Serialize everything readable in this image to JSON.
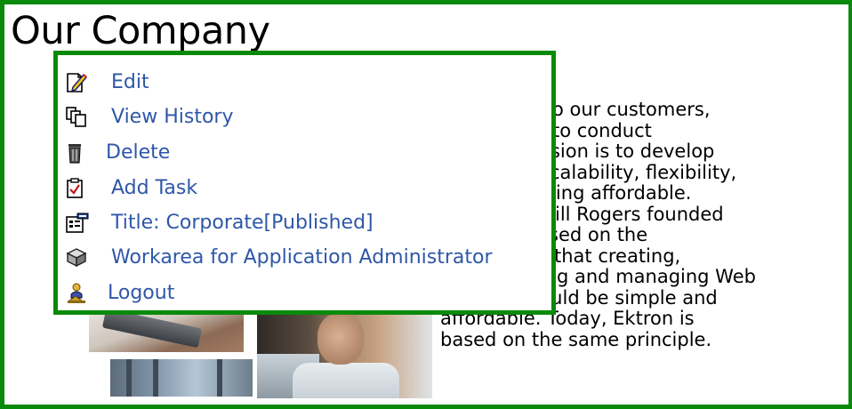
{
  "page": {
    "title": "Our Company",
    "body_lines": [
      "o our customers,",
      " to conduct",
      "ssion is to develop",
      "calability, flexibility,",
      "eing affordable.",
      "ill Rogers founded",
      "sed on the",
      " that creating,",
      "g and managing Web",
      "content should be simple and",
      "affordable.  Today, Ektron is",
      "based on the same principle."
    ]
  },
  "menu": {
    "items": [
      {
        "label": "Edit",
        "icon": "edit-icon"
      },
      {
        "label": "View History",
        "icon": "view-history-icon"
      },
      {
        "label": "Delete",
        "icon": "trash-icon"
      },
      {
        "label": "Add Task",
        "icon": "clipboard-check-icon"
      },
      {
        "label": "Title: Corporate[Published]",
        "icon": "properties-icon"
      },
      {
        "label": "Workarea for Application Administrator",
        "icon": "workarea-icon"
      },
      {
        "label": "Logout",
        "icon": "logout-icon"
      }
    ]
  },
  "colors": {
    "frame": "#0a8a0a",
    "link": "#2e57a8",
    "text": "#000000"
  }
}
